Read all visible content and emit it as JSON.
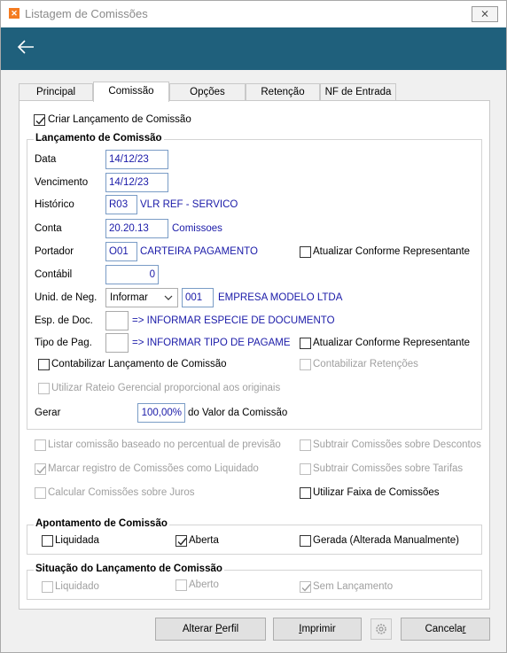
{
  "window": {
    "title": "Listagem de Comissões",
    "close_label": "⨯",
    "header_color": "#1f607c"
  },
  "tabs": [
    {
      "label": "Principal",
      "active": false
    },
    {
      "label": "Comissão",
      "active": true
    },
    {
      "label": "Opções",
      "active": false
    },
    {
      "label": "Retenção",
      "active": false
    },
    {
      "label": "NF de Entrada",
      "active": false
    }
  ],
  "criar_lancamento": {
    "label": "Criar Lançamento de Comissão",
    "checked": true
  },
  "lancamento": {
    "title": "Lançamento de Comissão",
    "data": {
      "label": "Data",
      "value": "14/12/23"
    },
    "vencimento": {
      "label": "Vencimento",
      "value": "14/12/23"
    },
    "historico": {
      "label": "Histórico",
      "code": "R03",
      "desc": "VLR REF - SERVICO"
    },
    "conta": {
      "label": "Conta",
      "code": "20.20.13",
      "desc": "Comissoes"
    },
    "portador": {
      "label": "Portador",
      "code": "O01",
      "desc": "CARTEIRA PAGAMENTO",
      "atualizar": "Atualizar Conforme Representante"
    },
    "contabil": {
      "label": "Contábil",
      "value": "0"
    },
    "unid_neg": {
      "label": "Unid. de Neg.",
      "select": "Informar",
      "code": "001",
      "desc": "EMPRESA MODELO LTDA"
    },
    "esp_doc": {
      "label": "Esp. de Doc.",
      "code": "",
      "desc": "=> INFORMAR ESPECIE DE DOCUMENTO"
    },
    "tipo_pag": {
      "label": "Tipo de Pag.",
      "code": "",
      "desc": "=> INFORMAR TIPO DE PAGAME",
      "atualizar": "Atualizar Conforme Representante"
    },
    "contabilizar": "Contabilizar Lançamento de Comissão",
    "contabilizar_retencoes": "Contabilizar Retenções",
    "rateio": "Utilizar Rateio Gerencial proporcional aos originais",
    "gerar": {
      "label": "Gerar",
      "value": "100,00%",
      "suffix": "do Valor da Comissão"
    }
  },
  "options": {
    "listar": "Listar comissão baseado no percentual de previsão",
    "subtrair_descontos": "Subtrair Comissões sobre Descontos",
    "marcar": "Marcar registro de Comissões como Liquidado",
    "subtrair_tarifas": "Subtrair Comissões sobre Tarifas",
    "calcular_juros": "Calcular Comissões sobre Juros",
    "utilizar_faixa": "Utilizar Faixa de Comissões"
  },
  "apontamento": {
    "title": "Apontamento de Comissão",
    "liquidada": "Liquidada",
    "aberta": "Aberta",
    "gerada": "Gerada (Alterada Manualmente)"
  },
  "situacao": {
    "title": "Situação do Lançamento de Comissão",
    "liquidado": "Liquidado",
    "aberto": "Aberto",
    "sem_lancamento": "Sem Lançamento"
  },
  "buttons": {
    "alterar_perfil_pre": "Alterar ",
    "alterar_perfil_u": "P",
    "alterar_perfil_post": "erfil",
    "imprimir_u": "I",
    "imprimir_post": "mprimir",
    "cancelar_pre": "Cancela",
    "cancelar_u": "r"
  }
}
